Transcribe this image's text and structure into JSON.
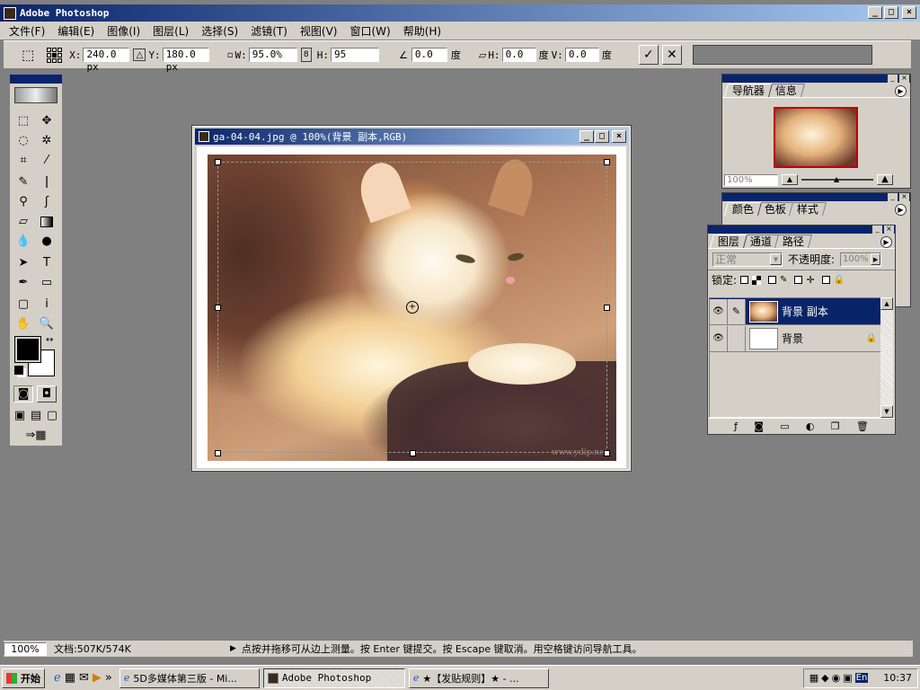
{
  "app": {
    "title": "Adobe Photoshop",
    "min": "_",
    "max": "□",
    "close": "×"
  },
  "menu": [
    "文件(F)",
    "编辑(E)",
    "图像(I)",
    "图层(L)",
    "选择(S)",
    "滤镜(T)",
    "视图(V)",
    "窗口(W)",
    "帮助(H)"
  ],
  "options": {
    "x_label": "X:",
    "x_value": "240.0 px",
    "y_label": "Y:",
    "y_value": "180.0 px",
    "w_label": "W:",
    "w_value": "95.0%",
    "h_label": "H:",
    "h_value": "95",
    "angle_value": "0.0",
    "angle_unit": "度",
    "skew_h_label": "H:",
    "skew_h_value": "0.0",
    "skew_h_unit": "度",
    "skew_v_label": "V:",
    "skew_v_value": "0.0",
    "skew_v_unit": "度",
    "commit": "✓",
    "cancel": "✕"
  },
  "document": {
    "title": "ga-04-04.jpg @ 100%(背景 副本,RGB)",
    "watermark": "www.ydip.net"
  },
  "navigator": {
    "tabs": [
      "导航器",
      "信息"
    ],
    "zoom": "100%"
  },
  "color_panel": {
    "tabs": [
      "颜色",
      "色板",
      "样式"
    ]
  },
  "layers": {
    "tabs": [
      "图层",
      "通道",
      "路径"
    ],
    "blend_mode": "正常",
    "opacity_label": "不透明度:",
    "opacity_value": "100%",
    "lock_label": "锁定:",
    "rows": [
      {
        "name": "背景 副本",
        "selected": true
      },
      {
        "name": "背景",
        "selected": false
      }
    ]
  },
  "status": {
    "zoom": "100%",
    "doc_size": "文档:507K/574K",
    "hint": "点按并拖移可从边上测量。按 Enter 键提交。按 Escape 键取消。用空格键访问导航工具。"
  },
  "taskbar": {
    "start": "开始",
    "more": "»",
    "tasks": [
      "5D多媒体第三版 - Mi...",
      "Adobe Photoshop",
      "★【发贴规则】★ - ..."
    ],
    "lang": "En",
    "clock": "10:37"
  },
  "colors": {
    "titlebar": "#0a246a",
    "selected_layer": "#0a246a",
    "chrome": "#d4d0c8",
    "workspace": "#808080"
  }
}
